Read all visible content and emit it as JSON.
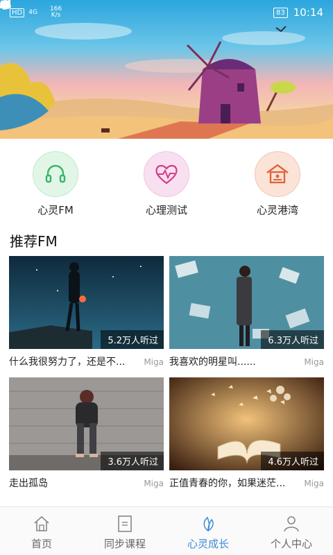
{
  "status_bar": {
    "hd_label": "HD",
    "network": "4G",
    "speed_value": "166",
    "speed_unit": "K/s",
    "battery": "83",
    "time": "10:14"
  },
  "quick_entries": [
    {
      "label": "心灵FM",
      "icon": "headphones-icon",
      "color": "#3bb36b",
      "bg": "#e2f6e7"
    },
    {
      "label": "心理测试",
      "icon": "heart-pulse-icon",
      "color": "#d23a8c",
      "bg": "#f8e0f1"
    },
    {
      "label": "心灵港湾",
      "icon": "home-icon",
      "color": "#e0643a",
      "bg": "#fbe3d8"
    }
  ],
  "section_title": "推荐FM",
  "cards": [
    {
      "title": "什么我很努力了，还是不...",
      "author": "Miga",
      "listeners": "5.2万人听过"
    },
    {
      "title": "我喜欢的明星叫......",
      "author": "Miga",
      "listeners": "6.3万人听过"
    },
    {
      "title": "走出孤岛",
      "author": "Miga",
      "listeners": "3.6万人听过"
    },
    {
      "title": "正值青春的你，如果迷茫...",
      "author": "Miga",
      "listeners": "4.6万人听过"
    }
  ],
  "bottom_nav": [
    {
      "label": "首页",
      "icon": "home-icon",
      "active": false
    },
    {
      "label": "同步课程",
      "icon": "document-icon",
      "active": false
    },
    {
      "label": "心灵成长",
      "icon": "leaf-icon",
      "active": true
    },
    {
      "label": "个人中心",
      "icon": "person-icon",
      "active": false
    }
  ],
  "colors": {
    "accent": "#3d8bd6",
    "text": "#222222",
    "muted": "#999999"
  }
}
